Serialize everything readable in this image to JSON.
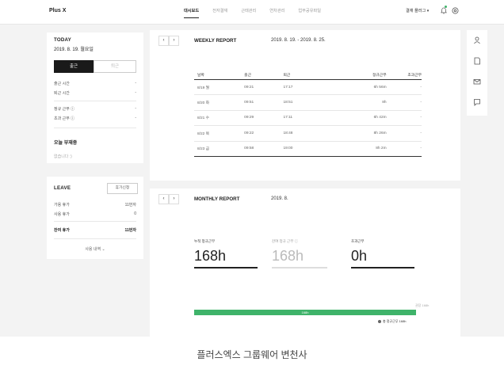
{
  "topbar": {
    "logo": "Plus X",
    "nav": [
      "대시보드",
      "전자결재",
      "근태관리",
      "연차관리",
      "업무공유파일"
    ],
    "user": "결재 플러그 ▾"
  },
  "today": {
    "title": "TODAY",
    "date": "2019. 8. 19. 월요일",
    "check_in": "출근",
    "check_out": "퇴근",
    "rows": [
      {
        "label": "출근 시간",
        "value": "-"
      },
      {
        "label": "퇴근 시간",
        "value": "-"
      },
      {
        "label": "정규 근무 ⓘ",
        "value": "-"
      },
      {
        "label": "초과 근무 ⓘ",
        "value": "-"
      }
    ],
    "absent_title": "오늘 부재중",
    "absent_empty": "없습니다 :)"
  },
  "leave": {
    "title": "LEAVE",
    "button": "휴가신청",
    "rows": [
      {
        "label": "가용 휴가",
        "value": "11번자"
      },
      {
        "label": "사용 휴가",
        "value": "0"
      },
      {
        "label": "잔여 휴가",
        "value": "11번자"
      }
    ],
    "usage_link": "사용 내역  ⌄"
  },
  "weekly": {
    "prev": "‹",
    "next": "›",
    "title": "WEEKLY REPORT",
    "range": "2019. 8. 19. - 2019. 8. 25.",
    "headers": [
      "날짜",
      "출근",
      "퇴근",
      "정규근무",
      "초과근무"
    ],
    "rows": [
      [
        "8/19 월",
        "09:21",
        "17:17",
        "6h 56m",
        "-"
      ],
      [
        "8/20 화",
        "09:51",
        "18:51",
        "8h",
        "-"
      ],
      [
        "8/21 수",
        "09:29",
        "17:11",
        "6h 42m",
        "-"
      ],
      [
        "8/22 목",
        "09:22",
        "18:48",
        "8h 26m",
        "-"
      ],
      [
        "8/23 금",
        "09:58",
        "19:00",
        "8h 2m",
        "-"
      ]
    ]
  },
  "monthly": {
    "prev": "‹",
    "next": "›",
    "title": "MONTHLY REPORT",
    "month": "2019. 8.",
    "stats": [
      {
        "label": "누적 정규근무",
        "value": "168h"
      },
      {
        "label": "잔여 정규 근무 ⓘ",
        "value": "168h"
      },
      {
        "label": "초과근무",
        "value": "0h"
      }
    ],
    "bar_axis": "권장 168h",
    "bar_label": "168h",
    "bar_progress": 1.0,
    "bar_legend": "총 정규근무 168h",
    "colors": {
      "accent": "#3fb36a"
    }
  },
  "rightbar_icons": [
    "user-icon",
    "document-icon",
    "mail-icon",
    "chat-icon"
  ],
  "caption": "플러스엑스 그룹웨어 변천사"
}
